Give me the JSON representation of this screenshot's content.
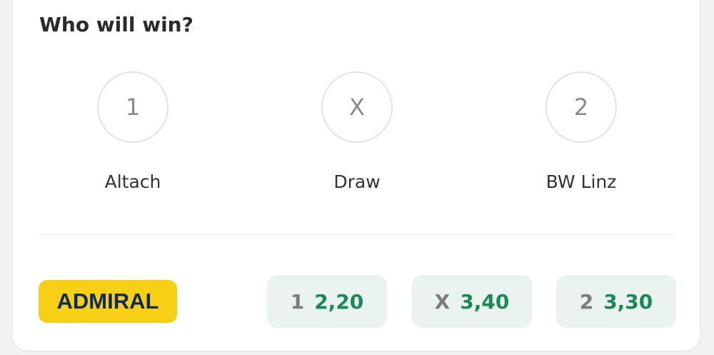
{
  "prediction": {
    "title": "Who will win?",
    "outcomes": [
      {
        "symbol": "1",
        "label": "Altach"
      },
      {
        "symbol": "X",
        "label": "Draw"
      },
      {
        "symbol": "2",
        "label": "BW Linz"
      }
    ]
  },
  "bookmaker": {
    "name": "ADMIRAL",
    "brand_color": "#f7cf17",
    "text_color": "#0f2a5a",
    "odds": [
      {
        "symbol": "1",
        "value": "2,20"
      },
      {
        "symbol": "X",
        "value": "3,40"
      },
      {
        "symbol": "2",
        "value": "3,30"
      }
    ]
  },
  "colors": {
    "odds_value": "#1a8a55",
    "odds_background": "#eaf3ef"
  }
}
